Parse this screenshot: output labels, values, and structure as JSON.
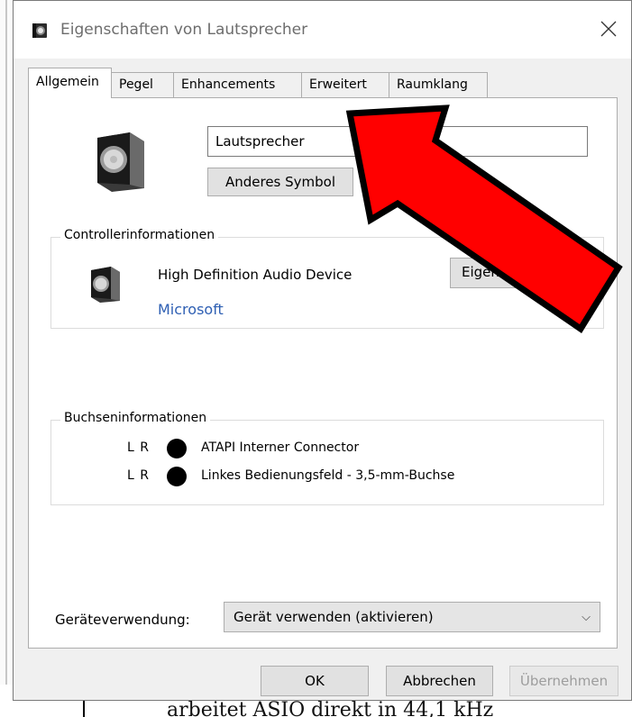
{
  "window": {
    "title": "Eigenschaften von Lautsprecher"
  },
  "tabs": [
    {
      "label": "Allgemein",
      "active": true
    },
    {
      "label": "Pegel",
      "active": false
    },
    {
      "label": "Enhancements",
      "active": false
    },
    {
      "label": "Erweitert",
      "active": false
    },
    {
      "label": "Raumklang",
      "active": false
    }
  ],
  "general": {
    "device_name_value": "Lautsprecher",
    "change_icon_label": "Anderes Symbol"
  },
  "controller": {
    "group_title": "Controllerinformationen",
    "device_name": "High Definition Audio Device",
    "vendor": "Microsoft",
    "properties_label": "Eigenschaften"
  },
  "jack": {
    "group_title": "Buchseninformationen",
    "rows": [
      {
        "channels": "L R",
        "label": "ATAPI Interner Connector"
      },
      {
        "channels": "L R",
        "label": "Linkes Bedienungsfeld - 3,5-mm-Buchse"
      }
    ]
  },
  "usage": {
    "label": "Geräteverwendung:",
    "selected": "Gerät verwenden (aktivieren)"
  },
  "buttons": {
    "ok": "OK",
    "cancel": "Abbrechen",
    "apply": "Übernehmen"
  },
  "background_text": "arbeitet ASIO direkt in 44,1 kHz",
  "colors": {
    "arrow_fill": "#ff0000",
    "link": "#2e5fb3",
    "dialog_bg": "#f0f0f0"
  },
  "icons": {
    "window": "speaker-icon",
    "close": "close-icon",
    "device": "speaker-icon",
    "dropdown": "chevron-down-icon"
  }
}
